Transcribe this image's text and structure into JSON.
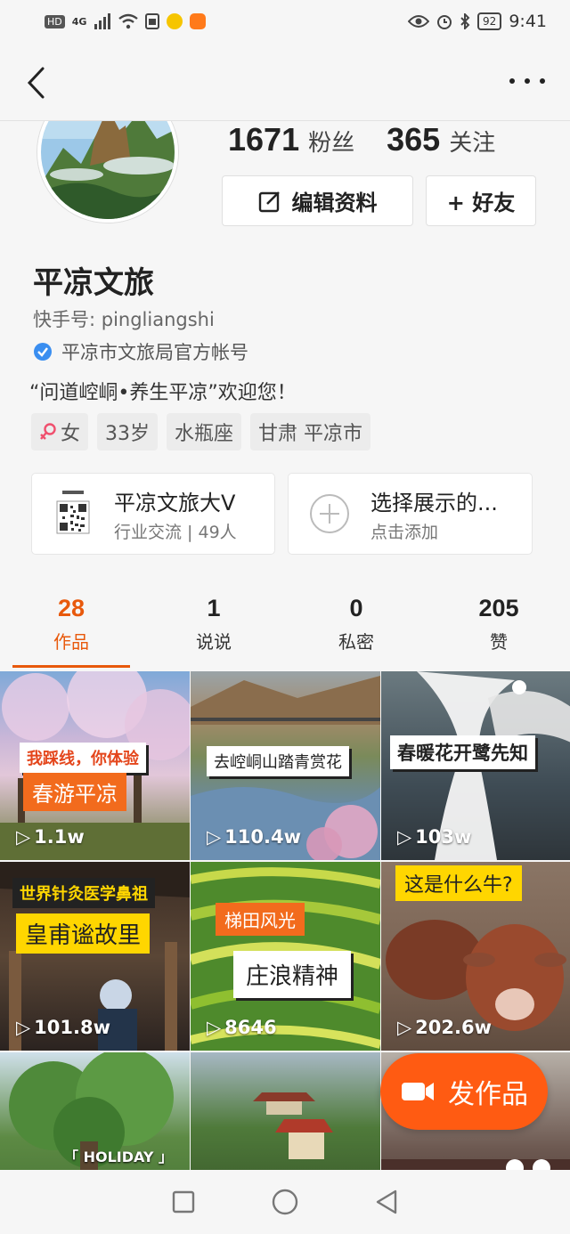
{
  "status_bar": {
    "hd": "HD",
    "network": "4G",
    "battery": "92",
    "time": "9:41"
  },
  "profile": {
    "followers_count": "1671",
    "followers_label": "粉丝",
    "following_count": "365",
    "following_label": "关注",
    "edit_label": "编辑资料",
    "add_friend_label": "+ 好友",
    "name": "平凉文旅",
    "kuaishou_id": "快手号: pingliangshi",
    "verified_text": "平凉市文旅局官方帐号",
    "bio": "“问道崆峒•养生平凉”欢迎您！",
    "tags": [
      {
        "label": "女",
        "icon": "female-icon"
      },
      {
        "label": "33岁"
      },
      {
        "label": "水瓶座"
      },
      {
        "label": "甘肃 平凉市"
      }
    ]
  },
  "cards": {
    "group_title": "平凉文旅大V",
    "group_sub": "行业交流 | 49人",
    "add_title": "选择展示的...",
    "add_sub": "点击添加"
  },
  "tabs": [
    {
      "count": "28",
      "label": "作品",
      "active": true
    },
    {
      "count": "1",
      "label": "说说"
    },
    {
      "count": "0",
      "label": "私密"
    },
    {
      "count": "205",
      "label": "赞"
    }
  ],
  "videos": [
    {
      "caption_top": "我踩线，你体验",
      "caption_main": "春游平凉",
      "plays": "1.1w"
    },
    {
      "caption_main": "去崆峒山踏青赏花",
      "plays": "110.4w"
    },
    {
      "caption_main": "春暖花开鹭先知",
      "plays": "103w"
    },
    {
      "caption_top": "世界针灸医学鼻祖",
      "caption_main": "皇甫谧故里",
      "plays": "101.8w"
    },
    {
      "caption_top": "梯田风光",
      "caption_main": "庄浪精神",
      "plays": "8646"
    },
    {
      "caption_main": "这是什么牛?",
      "plays": "202.6w"
    },
    {
      "caption_main": "「 HOLIDAY 」"
    },
    {},
    {}
  ],
  "post_button": "发作品",
  "colors": {
    "accent": "#e8590c",
    "fab": "#ff5b12"
  }
}
